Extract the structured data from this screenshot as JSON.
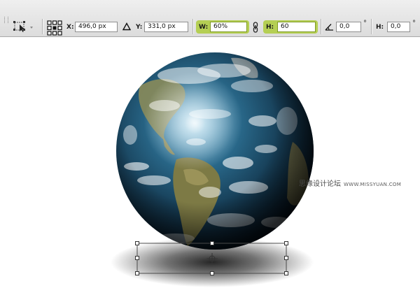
{
  "options_bar": {
    "x_label": "X:",
    "x_value": "496,0 px",
    "y_label": "Y:",
    "y_value": "331,0 px",
    "w_label": "W:",
    "w_value": "60%",
    "h_label": "H:",
    "h_value": "60",
    "rotate_value": "0,0",
    "rotate_unit": "°",
    "hskew_label": "H:",
    "hskew_value": "0,0",
    "hskew_unit": "°"
  },
  "canvas": {
    "watermark_cn": "思缘设计论坛",
    "watermark_site": "WWW.MISSYUAN.COM"
  },
  "colors": {
    "highlight": "#b5cf54",
    "toolbar_bg": "#e4e4e4"
  },
  "icons": {
    "tool_preset": "transform-selection-icon",
    "reference_point": "reference-point-grid-icon",
    "delta": "relative-position-triangle-icon",
    "link": "chain-link-icon",
    "rotate": "rotate-angle-icon"
  }
}
